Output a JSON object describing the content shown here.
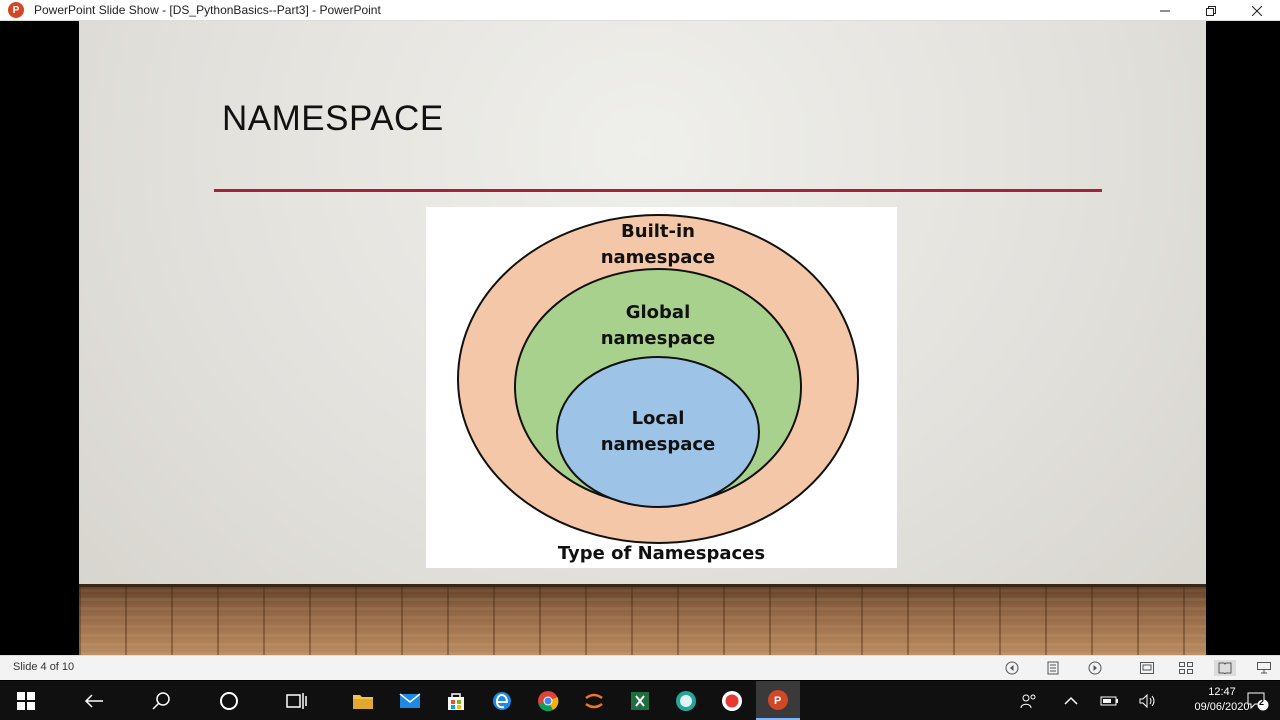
{
  "window": {
    "title": "PowerPoint Slide Show - [DS_PythonBasics--Part3] - PowerPoint",
    "app_icon_letter": "P",
    "minimize_icon": "minimize-icon",
    "restore_icon": "restore-icon",
    "close_icon": "close-icon"
  },
  "slide": {
    "title": "NAMESPACE",
    "rule_color": "#a3233a",
    "diagram": {
      "outer_label_line1": "Built-in",
      "outer_label_line2": "namespace",
      "middle_label_line1": "Global",
      "middle_label_line2": "namespace",
      "inner_label_line1": "Local",
      "inner_label_line2": "namespace",
      "caption": "Type of Namespaces",
      "colors": {
        "outer": "#f5c7a9",
        "middle": "#a9d18e",
        "inner": "#9dc3e6"
      }
    }
  },
  "statusbar": {
    "slide_counter": "Slide 4 of 10",
    "icons": [
      "previous-icon",
      "menu-icon",
      "next-icon",
      "normal-view-icon",
      "slide-sorter-icon",
      "reading-view-icon",
      "slideshow-icon"
    ]
  },
  "taskbar": {
    "icons": [
      "windows-start-icon",
      "back-icon",
      "search-icon",
      "cortana-icon",
      "task-view-icon",
      "file-explorer-icon",
      "mail-icon",
      "store-icon",
      "edge-icon",
      "chrome-icon",
      "jupyter-icon",
      "excel-icon",
      "app-icon",
      "record-icon",
      "powerpoint-icon"
    ],
    "tray_icons": [
      "people-icon",
      "chevron-up-icon",
      "battery-icon",
      "volume-icon",
      "notifications-icon"
    ],
    "time": "12:47",
    "date": "09/06/2020",
    "notification_count": "2"
  }
}
